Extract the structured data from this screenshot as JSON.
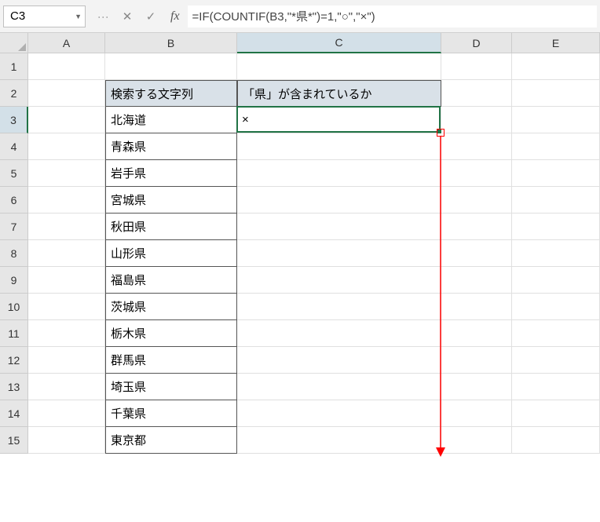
{
  "namebox": {
    "value": "C3"
  },
  "formula_bar": {
    "value": "=IF(COUNTIF(B3,\"*県*\")=1,\"○\",\"×\")"
  },
  "fx_label": "fx",
  "columns": [
    "A",
    "B",
    "C",
    "D",
    "E"
  ],
  "rows": [
    "1",
    "2",
    "3",
    "4",
    "5",
    "6",
    "7",
    "8",
    "9",
    "10",
    "11",
    "12",
    "13",
    "14",
    "15"
  ],
  "headers": {
    "B2": "検索する文字列",
    "C2": "「県」が含まれているか"
  },
  "data": {
    "B3": "北海道",
    "B4": "青森県",
    "B5": "岩手県",
    "B6": "宮城県",
    "B7": "秋田県",
    "B8": "山形県",
    "B9": "福島県",
    "B10": "茨城県",
    "B11": "栃木県",
    "B12": "群馬県",
    "B13": "埼玉県",
    "B14": "千葉県",
    "B15": "東京都",
    "C3": "×"
  },
  "active_cell": "C3"
}
